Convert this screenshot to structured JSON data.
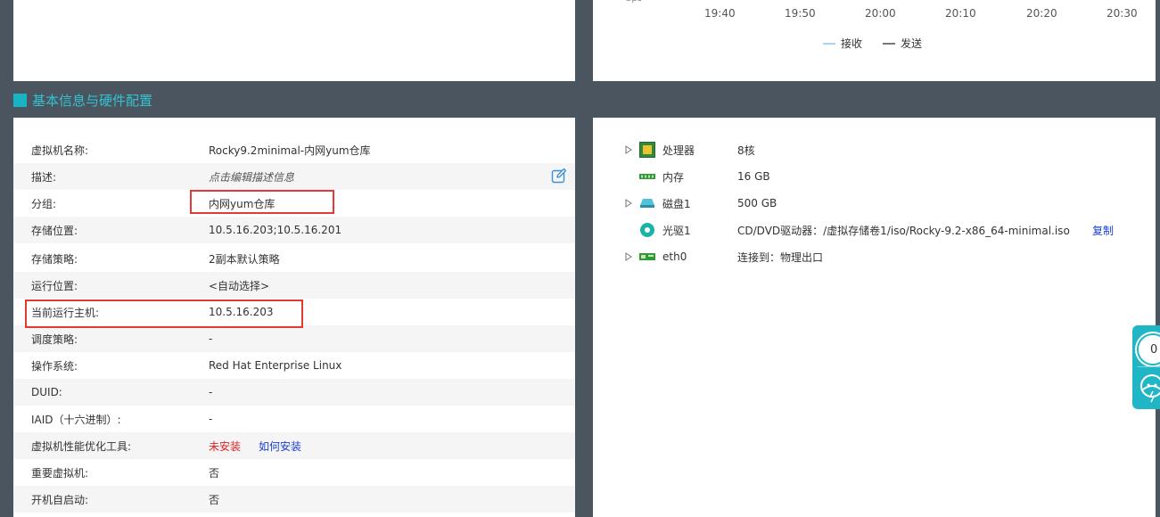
{
  "chart": {
    "cut_label": "bps",
    "ticks": [
      "19:40",
      "19:50",
      "20:00",
      "20:10",
      "20:20",
      "20:30"
    ],
    "legend": [
      {
        "name": "接收",
        "color": "#a9d4f2"
      },
      {
        "name": "发送",
        "color": "#777777"
      }
    ]
  },
  "section": {
    "title": "基本信息与硬件配置"
  },
  "info": {
    "vm_name": {
      "label": "虚拟机名称:",
      "value": "Rocky9.2minimal-内网yum仓库"
    },
    "description": {
      "label": "描述:",
      "value": "点击编辑描述信息"
    },
    "group": {
      "label": "分组:",
      "value": "内网yum仓库"
    },
    "storage_location": {
      "label": "存储位置:",
      "value": "10.5.16.203;10.5.16.201"
    },
    "storage_policy": {
      "label": "存储策略:",
      "value": "2副本默认策略"
    },
    "run_location": {
      "label": "运行位置:",
      "value": "<自动选择>"
    },
    "current_host": {
      "label": "当前运行主机:",
      "value": "10.5.16.203"
    },
    "schedule_policy": {
      "label": "调度策略:",
      "value": "-"
    },
    "os": {
      "label": "操作系统:",
      "value": "Red Hat Enterprise Linux"
    },
    "duid": {
      "label": "DUID:",
      "value": "-"
    },
    "iaid": {
      "label": "IAID（十六进制）:",
      "value": "-"
    },
    "perf_tools": {
      "label": "虚拟机性能优化工具:",
      "status": "未安装",
      "link": "如何安装"
    },
    "important": {
      "label": "重要虚拟机:",
      "value": "否"
    },
    "autostart": {
      "label": "开机自启动:",
      "value": "否"
    }
  },
  "hardware": {
    "cpu": {
      "name": "处理器",
      "value": "8核"
    },
    "memory": {
      "name": "内存",
      "value": "16 GB"
    },
    "disk": {
      "name": "磁盘1",
      "value": "500 GB"
    },
    "cdrom": {
      "name": "光驱1",
      "value": "CD/DVD驱动器：/虚拟存储卷1/iso/Rocky-9.2-x86_64-minimal.iso",
      "copy": "复制"
    },
    "nic": {
      "name": "eth0",
      "value": "连接到：物理出口"
    }
  },
  "widget": {
    "count": "0"
  },
  "colors": {
    "accent": "#19b4c4",
    "highlight": "#e53935",
    "link": "#1a3fd8",
    "warn": "#e02020"
  }
}
